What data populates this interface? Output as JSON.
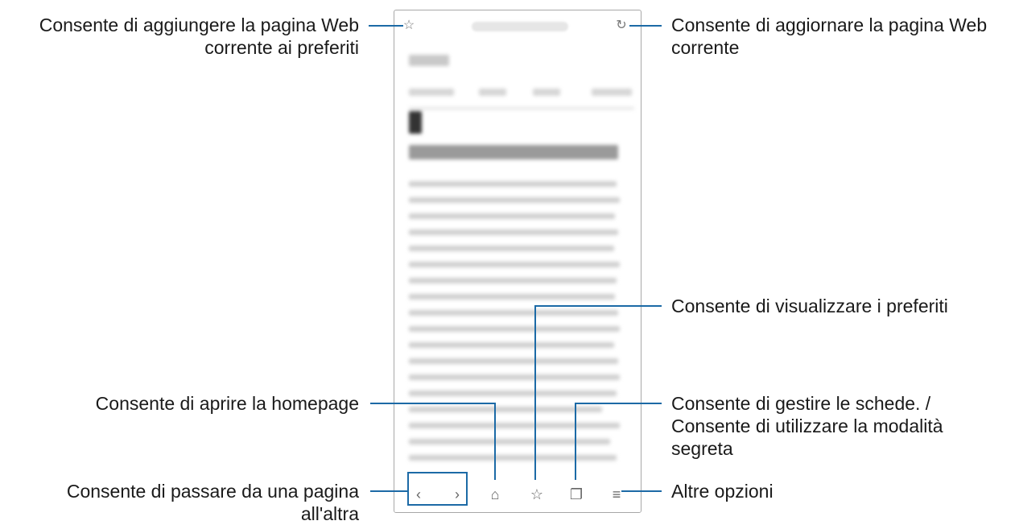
{
  "callouts": {
    "add_bookmark": [
      "Consente di aggiungere la pagina Web",
      "corrente ai preferiti"
    ],
    "refresh": [
      "Consente di aggiornare la pagina Web",
      "corrente"
    ],
    "view_bookmarks": [
      "Consente di visualizzare i preferiti"
    ],
    "homepage": [
      "Consente di aprire la homepage"
    ],
    "tabs": [
      "Consente di gestire le schede. /",
      "Consente di utilizzare la modalità",
      "segreta"
    ],
    "navigate": [
      "Consente di passare da una pagina",
      "all'altra"
    ],
    "more": [
      "Altre opzioni"
    ]
  },
  "icons": {
    "bookmark_add": "☆",
    "refresh": "↻",
    "back": "‹",
    "forward": "›",
    "home": "⌂",
    "bookmarks": "☆",
    "tabs": "❐",
    "menu": "≡"
  },
  "colors": {
    "callout_line": "#1c6aa6"
  }
}
